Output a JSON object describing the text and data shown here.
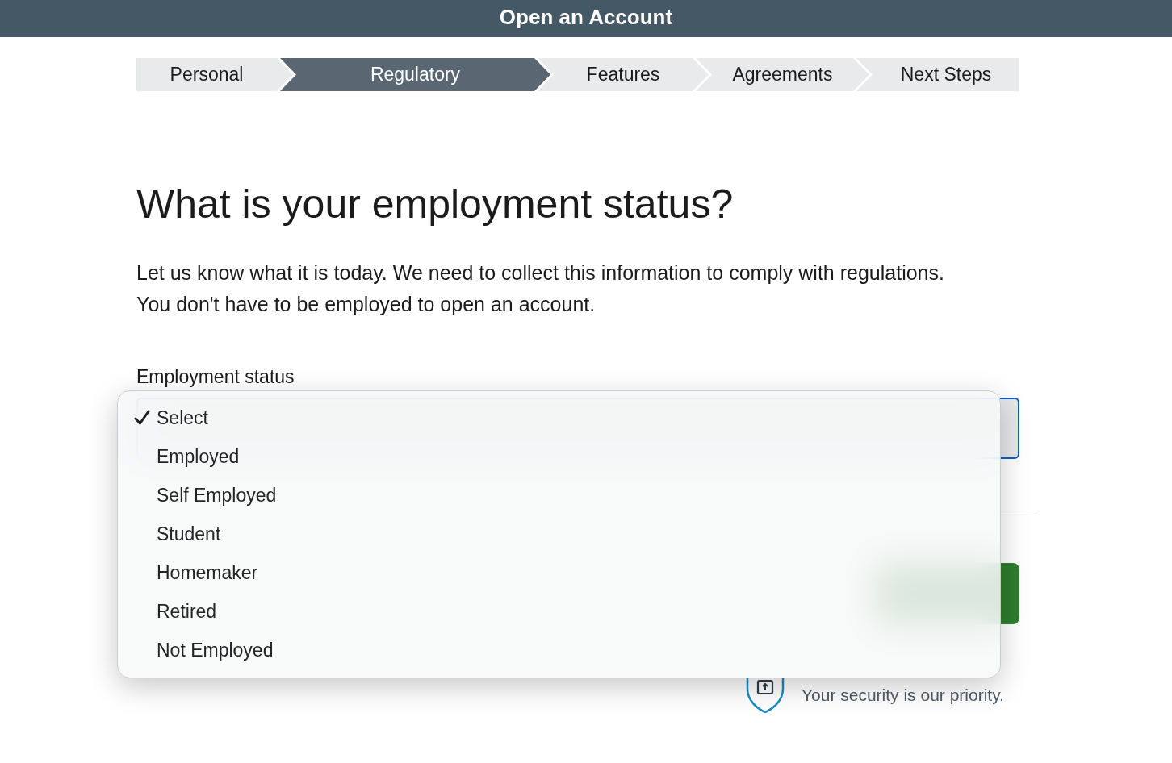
{
  "header": {
    "title": "Open an Account"
  },
  "steps": [
    {
      "label": "Personal",
      "selected": false
    },
    {
      "label": "Regulatory",
      "selected": true
    },
    {
      "label": "Features",
      "selected": false
    },
    {
      "label": "Agreements",
      "selected": false
    },
    {
      "label": "Next Steps",
      "selected": false
    }
  ],
  "question": {
    "heading": "What is your employment status?",
    "description": "Let us know what it is today. We need to collect this information to comply with regulations. You don't have to be employed to open an account."
  },
  "employment_field": {
    "label": "Employment status",
    "expanded": true,
    "options": [
      {
        "label": "Select",
        "selected": true
      },
      {
        "label": "Employed",
        "selected": false
      },
      {
        "label": "Self Employed",
        "selected": false
      },
      {
        "label": "Student",
        "selected": false
      },
      {
        "label": "Homemaker",
        "selected": false
      },
      {
        "label": "Retired",
        "selected": false
      },
      {
        "label": "Not Employed",
        "selected": false
      }
    ]
  },
  "actions": [
    {
      "kind": "primary"
    }
  ],
  "security_note": {
    "text": "Your security is our priority."
  }
}
